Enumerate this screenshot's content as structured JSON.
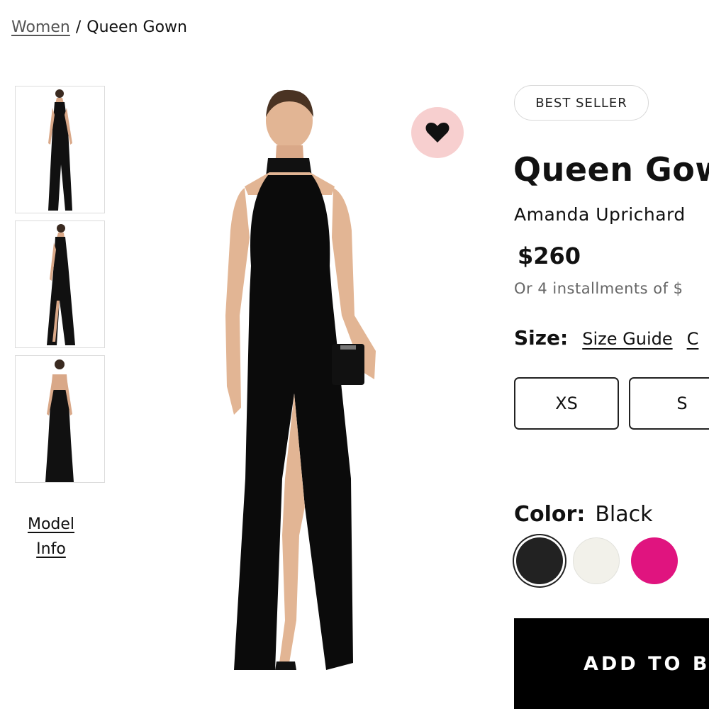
{
  "breadcrumb": {
    "parent": "Women",
    "separator": "/",
    "current": "Queen Gown"
  },
  "gallery": {
    "thumbnails": [
      {
        "icon": "dress-front-thumbnail"
      },
      {
        "icon": "dress-side-thumbnail"
      },
      {
        "icon": "dress-back-thumbnail"
      }
    ],
    "model_info_line1": "Model",
    "model_info_line2": "Info"
  },
  "wishlist": {
    "icon": "heart-icon",
    "color": "#f7cfcf"
  },
  "product": {
    "badge": "BEST SELLER",
    "title": "Queen Gow",
    "brand": "Amanda Uprichard",
    "price": "$260",
    "installments": "Or 4 installments of $"
  },
  "size": {
    "label": "Size:",
    "guide_label": "Size Guide",
    "extra_label": "C",
    "options": [
      "XS",
      "S"
    ]
  },
  "color": {
    "label": "Color:",
    "selected": "Black",
    "swatches": [
      {
        "name": "black",
        "hex": "#222222"
      },
      {
        "name": "white",
        "hex": "#f2f1ea"
      },
      {
        "name": "pink",
        "hex": "#e0147f"
      }
    ]
  },
  "cta": {
    "label": "ADD TO B"
  }
}
